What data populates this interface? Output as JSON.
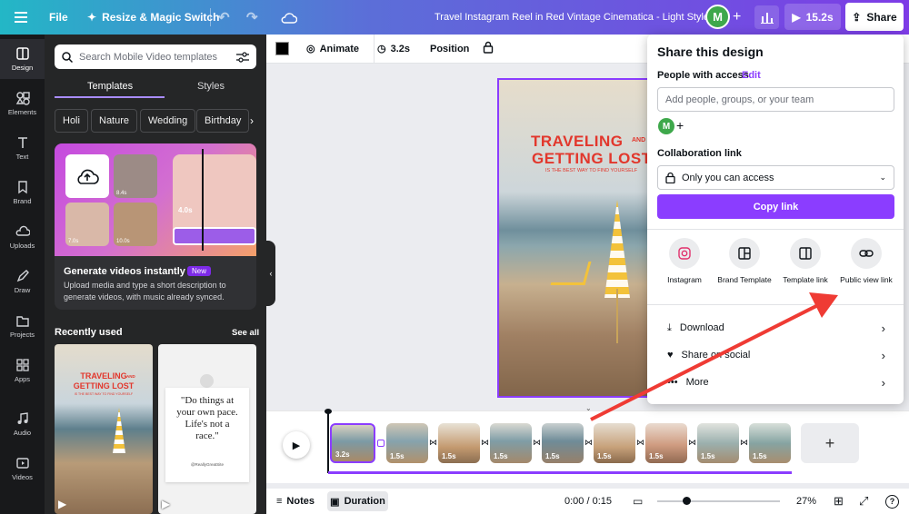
{
  "topbar": {
    "file": "File",
    "resize": "Resize & Magic Switch",
    "title": "Travel Instagram Reel in Red Vintage Cinematica - Light Style",
    "avatar": "M",
    "play_duration": "15.2s",
    "share": "Share"
  },
  "rail": [
    "Design",
    "Elements",
    "Text",
    "Brand",
    "Uploads",
    "Draw",
    "Projects",
    "Apps",
    "Audio",
    "Videos"
  ],
  "panel": {
    "search_placeholder": "Search Mobile Video templates",
    "tabs": [
      "Templates",
      "Styles"
    ],
    "chips": [
      "Holi",
      "Nature",
      "Wedding",
      "Birthday"
    ],
    "promo": {
      "title": "Generate videos instantly",
      "badge": "New",
      "desc": "Upload media and type a short description to generate videos, with music already synced.",
      "durations": [
        "8.4s",
        "4.0s",
        "7.0s",
        "10.0s"
      ]
    },
    "recent_title": "Recently used",
    "see_all": "See all",
    "thumb1": {
      "line1": "TRAVELING",
      "and": "AND",
      "line2": "GETTING LOST",
      "sub": "IS THE BEST WAY TO FIND YOURSELF"
    },
    "thumb2": {
      "quote": "\"Do things at your own pace. Life's not a race.\"",
      "handle": "@ReallyGreatSite"
    }
  },
  "toolbar": {
    "animate": "Animate",
    "duration": "3.2s",
    "position": "Position"
  },
  "canvas": {
    "line1": "TRAVELING",
    "and": "AND",
    "line2": "GETTING LOST",
    "sub": "IS THE BEST WAY TO FIND YOURSELF"
  },
  "timeline": {
    "clips": [
      "3.2s",
      "1.5s",
      "1.5s",
      "1.5s",
      "1.5s",
      "1.5s",
      "1.5s",
      "1.5s",
      "1.5s"
    ],
    "add": "+"
  },
  "bottombar": {
    "notes": "Notes",
    "duration": "Duration",
    "time": "0:00 / 0:15",
    "zoom": "27%"
  },
  "share": {
    "title": "Share this design",
    "people_label": "People with access",
    "edit": "Edit",
    "input_placeholder": "Add people, groups, or your team",
    "collab_label": "Collaboration link",
    "access": "Only you can access",
    "copy": "Copy link",
    "options": [
      "Instagram",
      "Brand Template",
      "Template link",
      "Public view link"
    ],
    "rows": [
      "Download",
      "Share on social",
      "More"
    ]
  },
  "colors": {
    "accent": "#8b3dff",
    "red_arrow": "#ef3b34",
    "title_red": "#e2372c"
  }
}
